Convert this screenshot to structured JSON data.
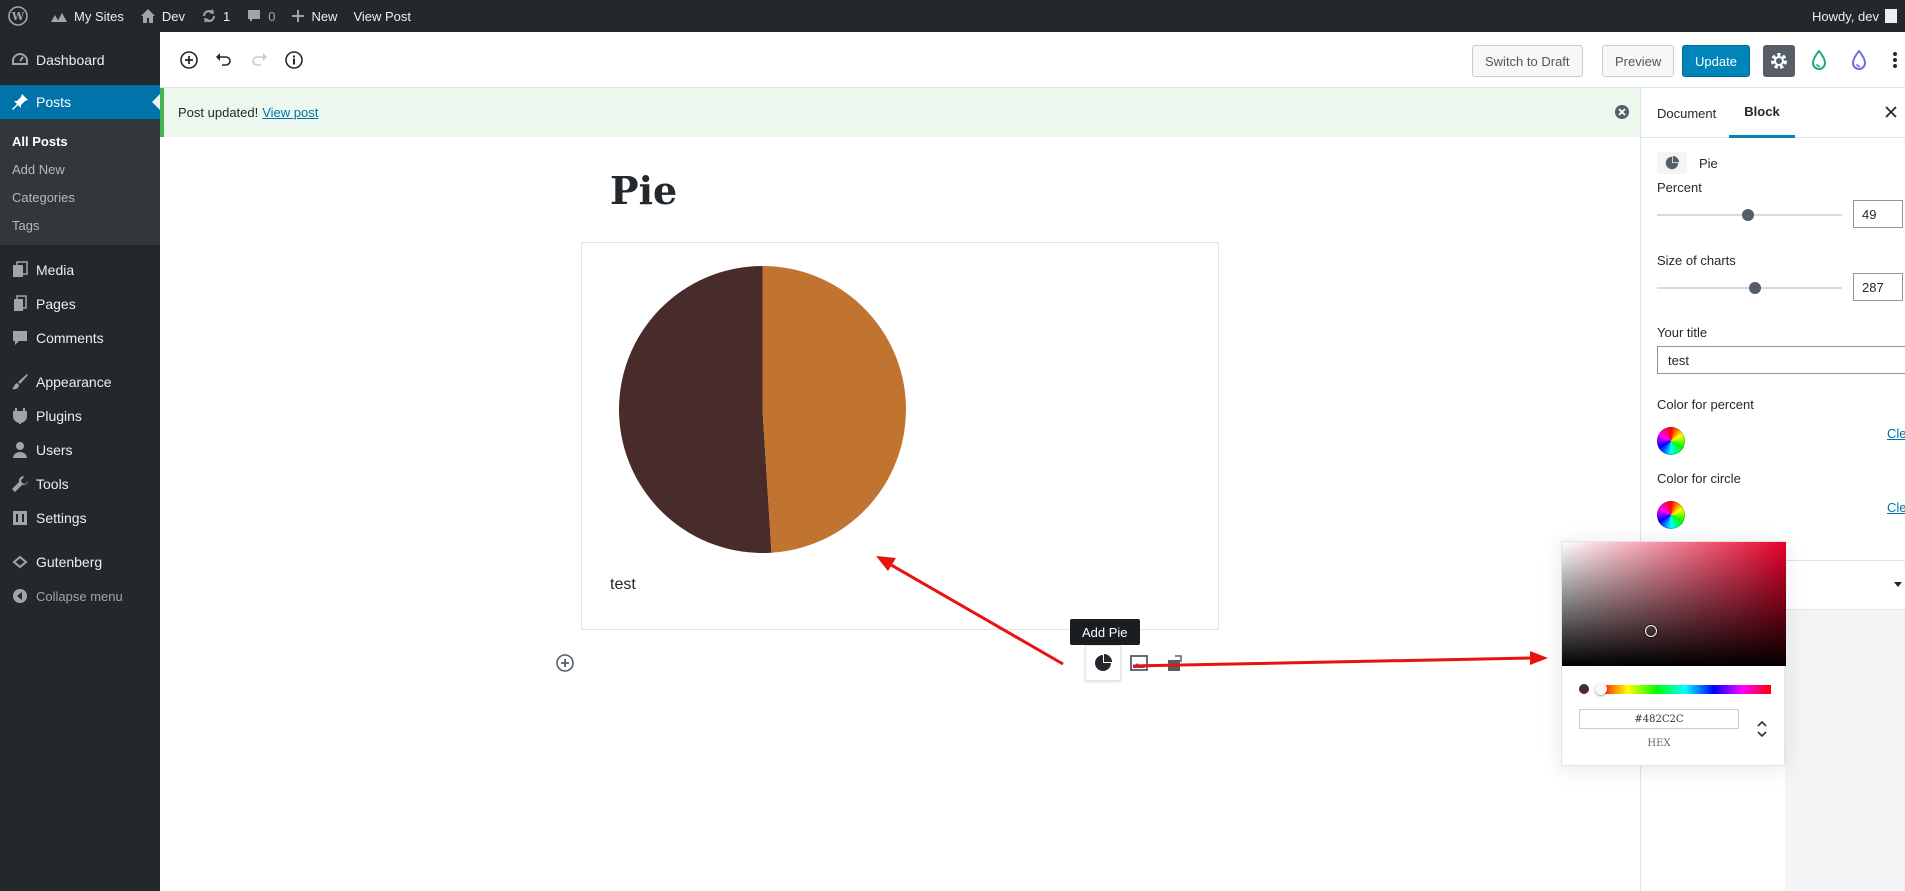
{
  "admin_bar": {
    "my_sites": "My Sites",
    "site_name": "Dev",
    "updates_count": "1",
    "comments_count": "0",
    "new_label": "New",
    "view_post": "View Post",
    "howdy": "Howdy, dev"
  },
  "menu": {
    "dashboard": "Dashboard",
    "posts": "Posts",
    "posts_sub": [
      "All Posts",
      "Add New",
      "Categories",
      "Tags"
    ],
    "media": "Media",
    "pages": "Pages",
    "comments": "Comments",
    "appearance": "Appearance",
    "plugins": "Plugins",
    "users": "Users",
    "tools": "Tools",
    "settings": "Settings",
    "gutenberg": "Gutenberg",
    "collapse": "Collapse menu"
  },
  "header": {
    "switch_to_draft": "Switch to Draft",
    "preview": "Preview",
    "update": "Update"
  },
  "notice": {
    "text": "Post updated!",
    "link": "View post"
  },
  "post": {
    "title": "Pie",
    "caption": "test"
  },
  "pie": {
    "percent": 49,
    "color_percent": "#c17430",
    "color_circle": "#482c2c"
  },
  "inserter": {
    "tooltip": "Add Pie"
  },
  "sidebar": {
    "tab_document": "Document",
    "tab_block": "Block",
    "block_name": "Pie",
    "percent_label": "Percent",
    "percent_value": "49",
    "percent_fraction": 0.49,
    "size_label": "Size of charts",
    "size_value": "287",
    "size_fraction": 0.53,
    "title_label": "Your title",
    "title_value": "test",
    "color_percent_label": "Color for percent",
    "color_circle_label": "Color for circle",
    "clear_label": "Cle"
  },
  "color_picker": {
    "hex_value": "#482C2C",
    "hex_label": "HEX"
  },
  "colors": {
    "accent": "#0085ba",
    "admin_bg": "#23282d",
    "arrow": "#e8130f"
  }
}
